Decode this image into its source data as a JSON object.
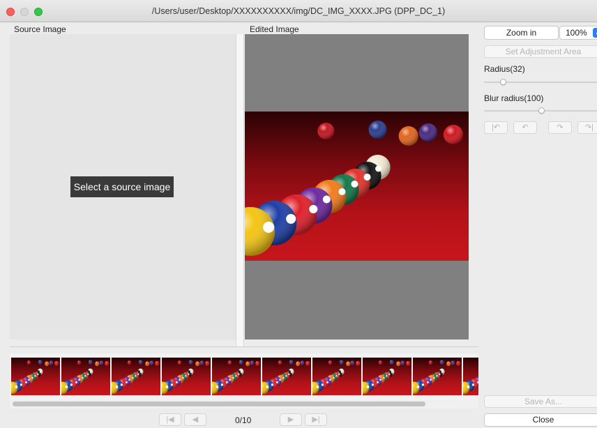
{
  "window": {
    "title": "/Users/user/Desktop/XXXXXXXXXX/img/DC_IMG_XXXX.JPG (DPP_DC_1)"
  },
  "panels": {
    "source_label": "Source Image",
    "edited_label": "Edited Image",
    "source_placeholder": "Select a source image"
  },
  "thumbnails": {
    "count_visible": 10
  },
  "pager": {
    "first_icon": "first-page-icon",
    "prev_icon": "prev-page-icon",
    "next_icon": "next-page-icon",
    "last_icon": "last-page-icon",
    "status": "0/10"
  },
  "controls": {
    "zoom_in_label": "Zoom in",
    "zoom_value": "100%",
    "set_area_label": "Set Adjustment Area",
    "radius_label": "Radius(32)",
    "radius_value": 32,
    "blur_label": "Blur radius(100)",
    "blur_value": 100,
    "history_icons": [
      "undo-all-icon",
      "undo-icon",
      "redo-icon",
      "redo-all-icon"
    ],
    "save_as_label": "Save As...",
    "close_label": "Close"
  },
  "colors": {
    "accent": "#2d7ef7",
    "felt": "#b2121a"
  }
}
